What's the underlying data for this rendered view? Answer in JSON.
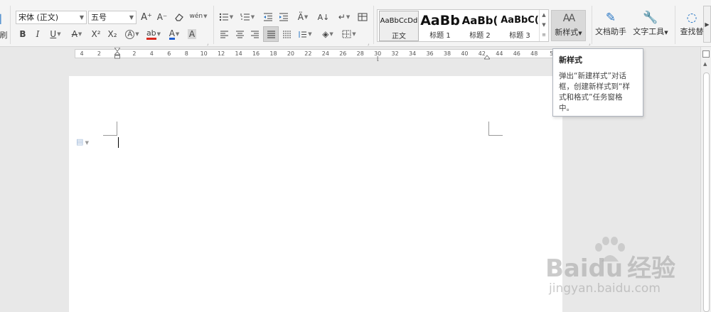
{
  "ribbon": {
    "clipboard": {
      "format_painter_label": "刷"
    },
    "font": {
      "font_name": "宋体 (正文)",
      "font_size": "五号",
      "increase_size": "A⁺",
      "decrease_size": "A⁻",
      "clear_format": "⌫",
      "phonetic": "wén",
      "bold": "B",
      "italic": "I",
      "underline": "U",
      "strikethrough": "A",
      "superscript": "X²",
      "subscript": "X₂",
      "text_effect": "A",
      "highlight": "ab",
      "font_color": "A",
      "char_shading": "A"
    },
    "styles": {
      "items": [
        {
          "preview": "AaBbCcDd",
          "label": "正文"
        },
        {
          "preview": "AaBb",
          "label": "标题 1"
        },
        {
          "preview": "AaBb(",
          "label": "标题 2"
        },
        {
          "preview": "AaBbC(",
          "label": "标题 3"
        }
      ],
      "new_style_label": "新样式",
      "new_style_icon": "AA"
    },
    "tools": {
      "doc_helper_label": "文档助手",
      "text_tools_label": "文字工具",
      "find_label": "查找替"
    }
  },
  "ruler": {
    "numbers": [
      "4",
      "2",
      "2",
      "4",
      "6",
      "8",
      "10",
      "12",
      "14",
      "16",
      "18",
      "20",
      "22",
      "24",
      "26",
      "28",
      "30",
      "32",
      "34",
      "36",
      "38",
      "40",
      "42",
      "44",
      "46",
      "48",
      "5"
    ]
  },
  "tooltip": {
    "title": "新样式",
    "body": "弹出“新建样式”对话框，创建新样式到“样式和格式”任务窗格中。"
  },
  "watermark": {
    "brand": "Baidu",
    "brand_cn": "经验",
    "url": "jingyan.baidu.com"
  },
  "colors": {
    "accent_red": "#d9281e",
    "accent_blue": "#1f5fd1",
    "ribbon_bg": "#f4f4f4"
  }
}
